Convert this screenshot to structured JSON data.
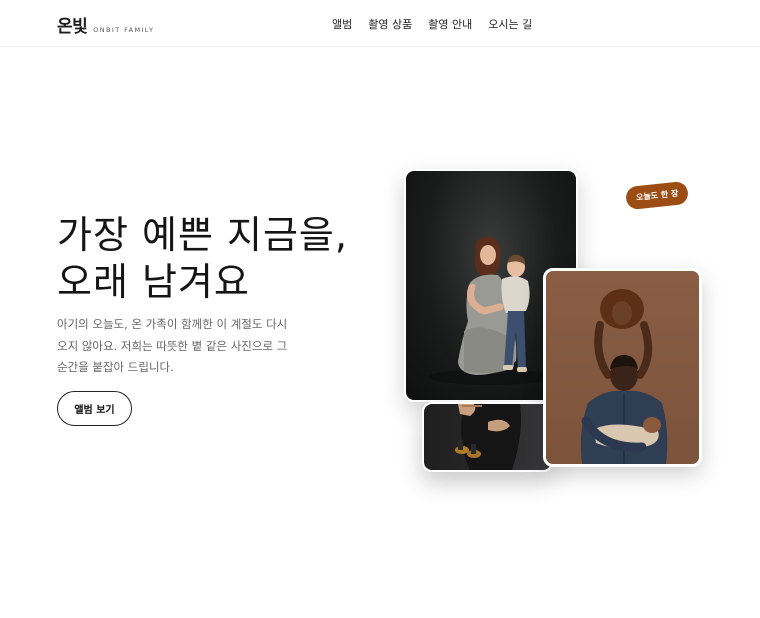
{
  "header": {
    "logo_ko": "온빛",
    "logo_en": "ONBIT FAMILY",
    "nav": [
      "앨범",
      "촬영 상품",
      "촬영 안내",
      "오시는 길"
    ]
  },
  "hero": {
    "headline_line1": "가장 예쁜 지금을,",
    "headline_line2": "오래 남겨요",
    "description": "아기의 오늘도, 온 가족이 함께한 이 계절도 다시 오지 않아요. 저희는 따뜻한 볕 같은 사진으로 그 순간을 붙잡아 드립니다.",
    "cta_label": "앨범 보기"
  },
  "gallery": {
    "badge": "오늘도 한 장",
    "badge_color": "#9b4d14"
  }
}
